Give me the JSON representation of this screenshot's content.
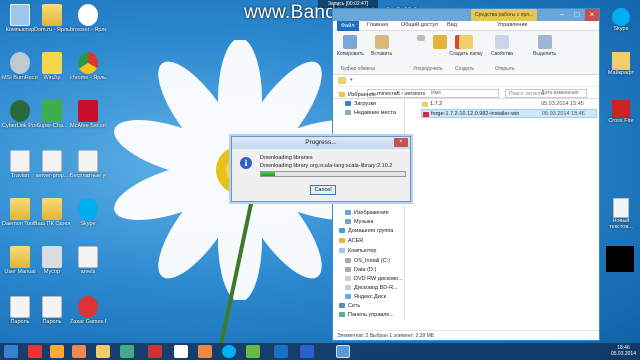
{
  "watermark": "www.Bandicam.com",
  "recording_text": "Запись [00:02:47]",
  "desktop_icons": [
    {
      "label": "Компьютер"
    },
    {
      "label": "Dom.ru - Ярлык"
    },
    {
      "label": "browser - Ярлык"
    },
    {
      "label": "MSI BurnRecov..."
    },
    {
      "label": "WinZip"
    },
    {
      "label": "chrome - Ярлык"
    },
    {
      "label": "CyberLink PowerDVD 10"
    },
    {
      "label": "Super-Cha..."
    },
    {
      "label": "McAfee Security S..."
    },
    {
      "label": "Travian"
    },
    {
      "label": "server-prop..."
    },
    {
      "label": "Бесплатные учиться р..."
    },
    {
      "label": "Daemon Tools Lit..."
    },
    {
      "label": "Ваш ПК Однокл..."
    },
    {
      "label": "Skype"
    },
    {
      "label": "User Manual"
    },
    {
      "label": "Mycop"
    },
    {
      "label": "arvels"
    },
    {
      "label": "Пароль"
    },
    {
      "label": "Пароль"
    },
    {
      "label": "Zaxar Games Browser"
    }
  ],
  "explorer": {
    "tools_tab": "Средства работы с ярл...",
    "menu": [
      "Файл",
      "Главная",
      "Общий доступ",
      "Вид",
      "Управление"
    ],
    "ribbon": {
      "copy": "Копировать",
      "paste": "Вставить",
      "new_folder": "Создать папку",
      "properties": "Свойства",
      "select": "Выделить",
      "group_clipboard": "Буфер обмена",
      "group_organize": "Упорядочить",
      "group_create": "Создать",
      "group_open": "Открыть"
    },
    "address": "« .minecraft › versions",
    "search_placeholder": "Поиск: versions",
    "columns": {
      "name": "Имя",
      "date": "Дата изменения"
    },
    "files": [
      {
        "name": "1.7.2",
        "date": "05.03.2014 15:45"
      },
      {
        "name": "forge-1.7.2-10.12.0.982-installer-win",
        "date": "05.03.2014 18:46"
      }
    ],
    "nav_items": [
      "Избранное",
      "Загрузки",
      "Недавние места",
      "Изображения",
      "Музыка",
      "Домашняя группа",
      "ACER",
      "Компьютер",
      "OS_Install (C:)",
      "Data (D:)",
      "DVD RW дисково...",
      "Дисковод BD-R...",
      "Яндекс.Диск",
      "Сеть",
      "Панель управле..."
    ],
    "status": "Элементов: 2     Выбран 1 элемент: 2,39 МБ"
  },
  "dialog": {
    "title": "Progress...",
    "line1": "Downloading libraries",
    "line2": "Downloading library org.scala-lang:scala-library:2.10.2",
    "progress": 0.1,
    "cancel": "Cancel"
  },
  "right_icons": [
    {
      "label": "Skype"
    },
    {
      "label": "Майкрафт"
    },
    {
      "label": "Cross Fire"
    },
    {
      "label": "Новый текстов..."
    }
  ],
  "tray": {
    "time": "18:46",
    "date": "05.03.2014"
  }
}
